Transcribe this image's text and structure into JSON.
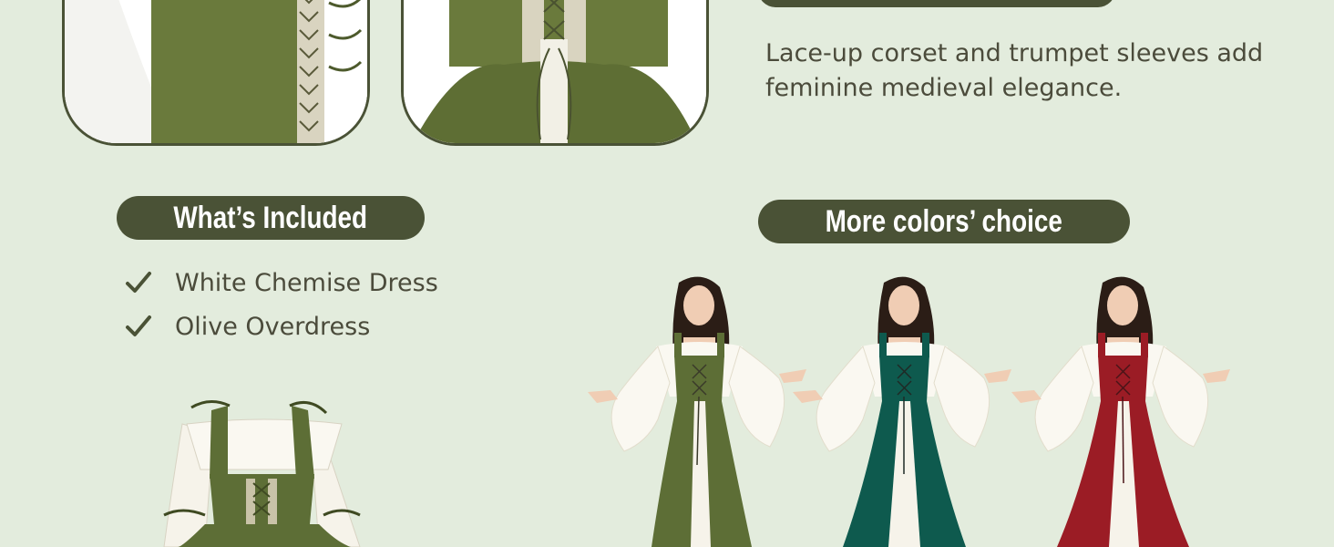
{
  "feature": {
    "description_lines": [
      "Lace-up corset and trumpet sleeves add",
      "feminine medieval elegance."
    ]
  },
  "included": {
    "heading": "What’s Included",
    "items": [
      {
        "label": "White Chemise Dress",
        "icon": "checkmark-icon"
      },
      {
        "label": "Olive Overdress",
        "icon": "checkmark-icon"
      }
    ]
  },
  "colors": {
    "heading": "More colors’ choice",
    "options": [
      {
        "name": "olive",
        "hex": "#5d6e36"
      },
      {
        "name": "teal",
        "hex": "#0e5a4e"
      },
      {
        "name": "burgundy",
        "hex": "#9b1c25"
      }
    ]
  },
  "theme": {
    "background": "#e3ecdd",
    "pill": "#4a5236",
    "text": "#4b4b3b",
    "olive": "#5d6e36"
  }
}
